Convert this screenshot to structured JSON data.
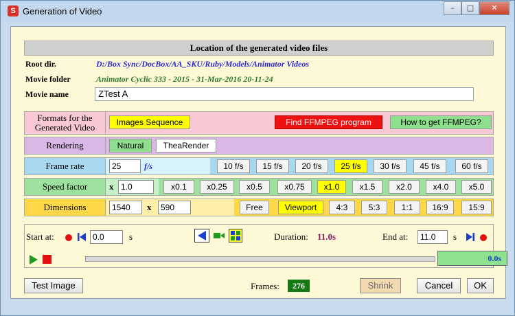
{
  "window": {
    "title": "Generation of Video",
    "app_icon": "S",
    "minimize": "–",
    "maximize": "□",
    "close": "✕"
  },
  "location": {
    "header": "Location of the generated video files",
    "root_label": "Root dir.",
    "root_value": "D:/Box Sync/DocBox/AA_SKU/Ruby/Models/Animator Videos",
    "folder_label": "Movie folder",
    "folder_value": "Animator Cyclic 333 - 2015 - 31-Mar-2016 20-11-24",
    "name_label": "Movie name",
    "name_value": "ZTest A"
  },
  "formats": {
    "label_line1": "Formats for the",
    "label_line2": "Generated Video",
    "images_sequence": "Images Sequence",
    "find_ffmpeg": "Find FFMPEG program",
    "how_ffmpeg": "How to get FFMPEG?"
  },
  "rendering": {
    "label": "Rendering",
    "natural": "Natural",
    "thea": "TheaRender"
  },
  "frame_rate": {
    "label": "Frame rate",
    "value": "25",
    "unit": "f/s",
    "options": [
      "10 f/s",
      "15 f/s",
      "20 f/s",
      "25 f/s",
      "30 f/s",
      "45 f/s",
      "60 f/s"
    ],
    "selected": "25 f/s"
  },
  "speed": {
    "label": "Speed factor",
    "x": "x",
    "value": "1.0",
    "options": [
      "x0.1",
      "x0.25",
      "x0.5",
      "x0.75",
      "x1.0",
      "x1.5",
      "x2.0",
      "x4.0",
      "x5.0"
    ],
    "selected": "x1.0"
  },
  "dimensions": {
    "label": "Dimensions",
    "width": "1540",
    "x": "x",
    "height": "590",
    "options": [
      "Free",
      "Viewport",
      "4:3",
      "5:3",
      "1:1",
      "16:9",
      "15:9"
    ],
    "selected": "Viewport"
  },
  "playback": {
    "start_label": "Start at:",
    "start_value": "0.0",
    "start_unit": "s",
    "duration_label": "Duration:",
    "duration_value": "11.0s",
    "end_label": "End at:",
    "end_value": "11.0",
    "end_unit": "s",
    "current_time": "0.0s",
    "progress": 0
  },
  "footer": {
    "test_image": "Test Image",
    "frames_label": "Frames:",
    "frames_value": "276",
    "shrink": "Shrink",
    "cancel": "Cancel",
    "ok": "OK"
  },
  "colors": {
    "formats_bg": "#f8c8d4",
    "rendering_bg": "#d9b8e6",
    "frame_rate_bg": "#a8d8ef",
    "speed_bg": "#9ee09e",
    "dimensions_bg": "#ffd84a",
    "selected": "#ffff00"
  }
}
